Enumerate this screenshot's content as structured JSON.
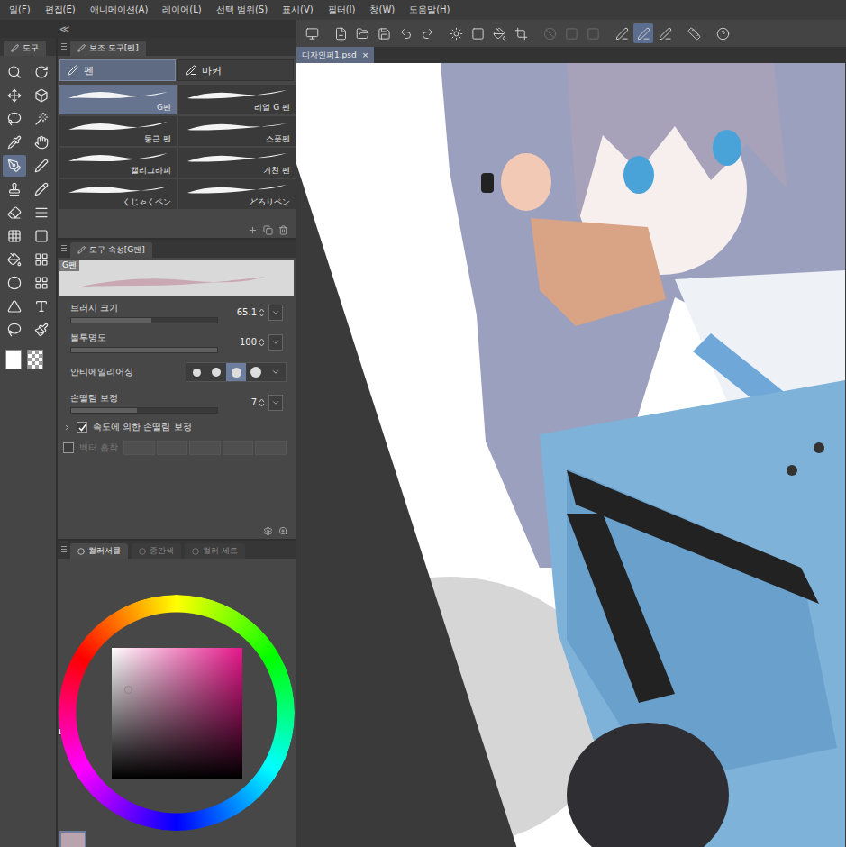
{
  "window": {
    "file_tab": "디자인퍼1.psd",
    "close": "×"
  },
  "menu": [
    "일(F)",
    "편집(E)",
    "애니메이션(A)",
    "레이어(L)",
    "선택 범위(S)",
    "표시(V)",
    "필터(I)",
    "창(W)",
    "도움말(H)"
  ],
  "collapse": "≪",
  "command_buttons": [
    {
      "selected": false,
      "disabled": false
    },
    {
      "selected": false,
      "disabled": false
    },
    {
      "selected": false,
      "disabled": false
    },
    {
      "selected": false,
      "disabled": false
    },
    {
      "selected": false,
      "disabled": false
    },
    {
      "selected": false,
      "disabled": false
    },
    {
      "selected": false,
      "disabled": false
    },
    {
      "selected": false,
      "disabled": false
    },
    {
      "selected": false,
      "disabled": false
    },
    {
      "selected": false,
      "disabled": false
    },
    {
      "selected": false,
      "disabled": true
    },
    {
      "selected": false,
      "disabled": true
    },
    {
      "selected": false,
      "disabled": true
    },
    {
      "selected": false,
      "disabled": false
    },
    {
      "selected": true,
      "disabled": false
    },
    {
      "selected": false,
      "disabled": false
    },
    {
      "selected": false,
      "disabled": false
    },
    {
      "selected": false,
      "disabled": false
    }
  ],
  "tool_panel": {
    "tab": "도구",
    "tools": [
      {
        "selected": false
      },
      {
        "selected": false
      },
      {
        "selected": false
      },
      {
        "selected": false
      },
      {
        "selected": false
      },
      {
        "selected": false
      },
      {
        "selected": false
      },
      {
        "selected": false
      },
      {
        "selected": true
      },
      {
        "selected": false
      },
      {
        "selected": false
      },
      {
        "selected": false
      },
      {
        "selected": false
      },
      {
        "selected": false
      },
      {
        "selected": false
      },
      {
        "selected": false
      },
      {
        "selected": false
      },
      {
        "selected": false
      },
      {
        "selected": false
      },
      {
        "selected": false
      },
      {
        "selected": false
      },
      {
        "selected": false
      },
      {
        "selected": false
      },
      {
        "selected": false
      }
    ],
    "main_color": "#ffffff"
  },
  "subtool_panel": {
    "tab": "보조 도구[펜]",
    "groups": [
      {
        "label": "펜",
        "selected": true
      },
      {
        "label": "마커",
        "selected": false
      }
    ],
    "brushes": [
      {
        "label": "G펜",
        "selected": true
      },
      {
        "label": "리얼 G 펜",
        "selected": false
      },
      {
        "label": "둥근 펜",
        "selected": false
      },
      {
        "label": "스푼펜",
        "selected": false
      },
      {
        "label": "캘리그라피",
        "selected": false
      },
      {
        "label": "거친 펜",
        "selected": false
      },
      {
        "label": "くじゃくペン",
        "selected": false
      },
      {
        "label": "どろりペン",
        "selected": false
      }
    ]
  },
  "tool_property": {
    "tab": "도구 속성[G펜]",
    "preview_label": "G펜",
    "brush_size": {
      "label": "브러시 크기",
      "value": "65.1",
      "level": 0.55
    },
    "opacity": {
      "label": "불투명도",
      "value": "100",
      "level": 1
    },
    "antialiasing": {
      "label": "안티에일리어싱",
      "options": [
        {
          "selected": false
        },
        {
          "selected": false
        },
        {
          "selected": true
        },
        {
          "selected": false
        }
      ]
    },
    "stabilization": {
      "label": "손떨림 보정",
      "value": "7",
      "level": 0.45
    },
    "speed_stabilization": {
      "label": "속도에 의한 손떨림 보정",
      "checked": true
    },
    "vector_snap": {
      "label": "벡터 흡착",
      "disabled": true
    }
  },
  "color_panel": {
    "tabs": [
      {
        "label": "컬러서클",
        "selected": true
      },
      {
        "label": "중간색",
        "selected": false
      },
      {
        "label": "컬러 세트",
        "selected": false
      }
    ],
    "hue": "#e6178a",
    "main_color": "#b9a3ad",
    "sub_color": "#ffffff"
  }
}
